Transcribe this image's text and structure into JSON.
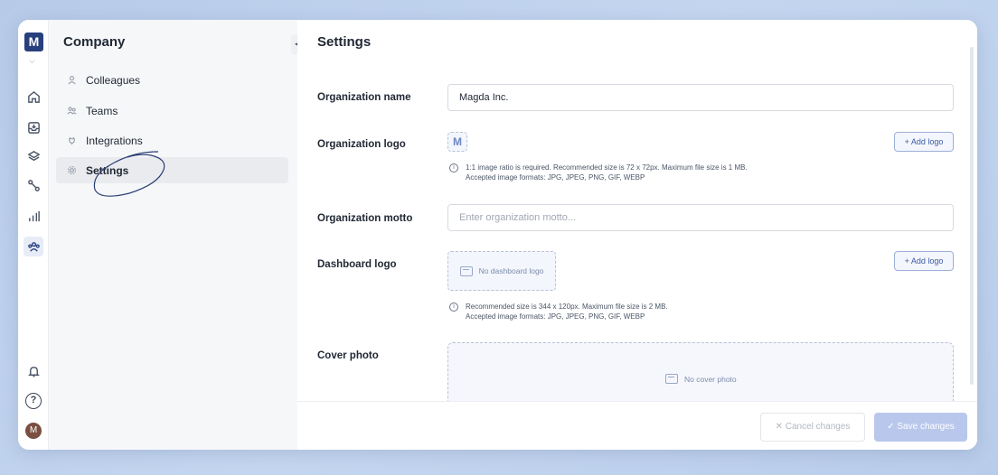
{
  "rail": {
    "logo_letter": "M",
    "avatar_letter": "M",
    "help_glyph": "?",
    "icons": [
      "home-icon",
      "inbox-icon",
      "layers-icon",
      "workflow-icon",
      "chart-icon",
      "team-icon",
      "bell-icon",
      "help-icon"
    ]
  },
  "sidebar": {
    "title": "Company",
    "items": [
      {
        "label": "Colleagues",
        "icon": "user-icon"
      },
      {
        "label": "Teams",
        "icon": "users-icon"
      },
      {
        "label": "Integrations",
        "icon": "plug-icon"
      },
      {
        "label": "Settings",
        "icon": "gear-icon",
        "active": true
      }
    ]
  },
  "main": {
    "title": "Settings",
    "org_name": {
      "label": "Organization name",
      "value": "Magda Inc."
    },
    "org_logo": {
      "label": "Organization logo",
      "logo_letter": "M",
      "add_button": "+ Add logo",
      "info_line1": "1:1 image ratio is required. Recommended size is 72 x 72px. Maximum file size is 1 MB.",
      "info_line2": "Accepted image formats: JPG, JPEG, PNG, GIF, WEBP"
    },
    "org_motto": {
      "label": "Organization motto",
      "placeholder": "Enter organization motto..."
    },
    "dashboard_logo": {
      "label": "Dashboard logo",
      "empty_text": "No dashboard logo",
      "add_button": "+ Add logo",
      "info_line1": "Recommended size is 344 x 120px. Maximum file size is 2 MB.",
      "info_line2": "Accepted image formats: JPG, JPEG, PNG, GIF, WEBP"
    },
    "cover_photo": {
      "label": "Cover photo",
      "empty_text": "No cover photo"
    }
  },
  "footer": {
    "cancel_label": "Cancel changes",
    "save_label": "Save changes"
  },
  "colors": {
    "brand": "#27407d",
    "accent": "#3c5aa6",
    "save_disabled": "#b9c7ec"
  }
}
